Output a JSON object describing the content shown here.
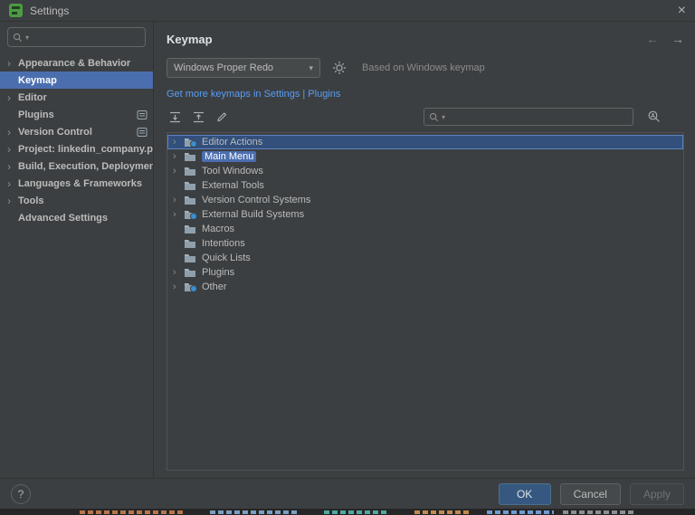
{
  "glyphs": {
    "chevron": "›",
    "caret": "▾",
    "close": "×",
    "back": "←",
    "forward": "→"
  },
  "colors": {
    "selection_blue": "#4b6eaf",
    "link_blue": "#589df6",
    "ok_button_blue": "#365880",
    "app_icon_green": "#4d9b44"
  },
  "titlebar": {
    "title": "Settings"
  },
  "sidebar": {
    "search": {
      "placeholder": ""
    },
    "items": [
      {
        "label": "Appearance & Behavior"
      },
      {
        "label": "Keymap"
      },
      {
        "label": "Editor"
      },
      {
        "label": "Plugins"
      },
      {
        "label": "Version Control"
      },
      {
        "label": "Project: linkedin_company.py"
      },
      {
        "label": "Build, Execution, Deployment"
      },
      {
        "label": "Languages & Frameworks"
      },
      {
        "label": "Tools"
      },
      {
        "label": "Advanced Settings"
      }
    ]
  },
  "keymap": {
    "title": "Keymap",
    "scheme": {
      "value": "Windows Proper Redo"
    },
    "based_on": "Based on Windows keymap",
    "more_link": "Get more keymaps in Settings | Plugins",
    "search": {
      "placeholder": ""
    },
    "tree": [
      {
        "label": "Editor Actions"
      },
      {
        "label": "Main Menu"
      },
      {
        "label": "Tool Windows"
      },
      {
        "label": "External Tools"
      },
      {
        "label": "Version Control Systems"
      },
      {
        "label": "External Build Systems"
      },
      {
        "label": "Macros"
      },
      {
        "label": "Intentions"
      },
      {
        "label": "Quick Lists"
      },
      {
        "label": "Plugins"
      },
      {
        "label": "Other"
      }
    ]
  },
  "footer": {
    "help": "?",
    "ok": "OK",
    "cancel": "Cancel",
    "apply": "Apply"
  }
}
